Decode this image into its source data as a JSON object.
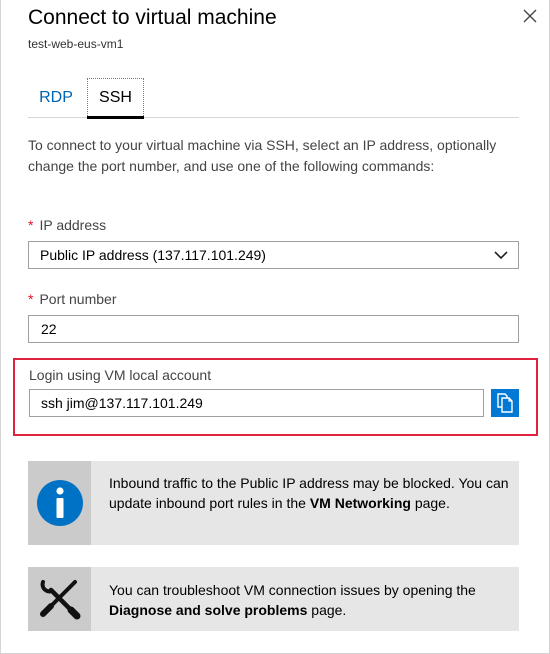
{
  "header": {
    "title": "Connect to virtual machine",
    "subtitle": "test-web-eus-vm1"
  },
  "tabs": [
    {
      "label": "RDP",
      "selected": false
    },
    {
      "label": "SSH",
      "selected": true
    }
  ],
  "description": "To connect to your virtual machine via SSH, select an IP address, optionally change the port number, and use one of the following commands:",
  "ip_address": {
    "required_mark": "*",
    "label": "IP address",
    "selected_value": "Public IP address (137.117.101.249)"
  },
  "port": {
    "required_mark": "*",
    "label": "Port number",
    "value": "22"
  },
  "login": {
    "label": "Login using VM local account",
    "command": "ssh jim@137.117.101.249"
  },
  "info_card": {
    "icon": "info-icon",
    "text_part1": "Inbound traffic to the Public IP address may be blocked. You can update inbound port rules in the ",
    "link": "VM Networking",
    "text_part2": " page."
  },
  "troubleshoot_card": {
    "icon": "tools-icon",
    "text_part1": "You can troubleshoot VM connection issues by opening the ",
    "link": "Diagnose and solve problems",
    "text_part2": " page."
  },
  "colors": {
    "accent": "#0078d4",
    "tab_link": "#0063b1",
    "highlight_border": "#e0213f",
    "required": "#e81123",
    "card_background": "#e6e6e6"
  }
}
